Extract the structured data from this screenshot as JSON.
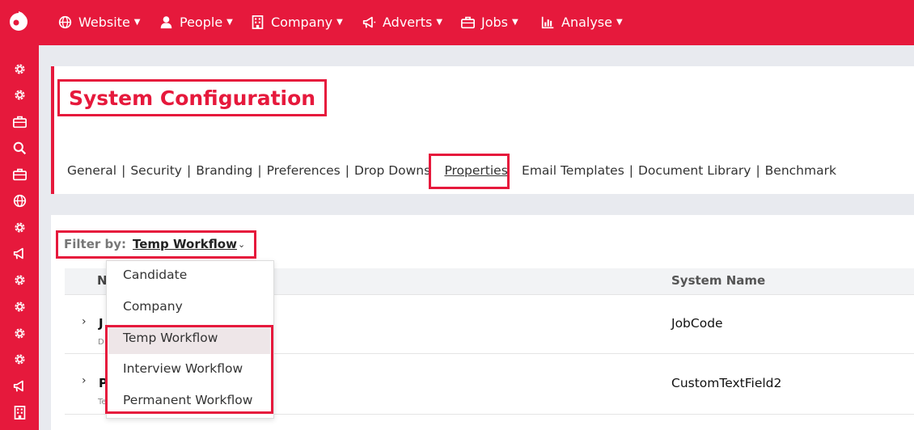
{
  "topnav": {
    "items": [
      {
        "label": "Website",
        "icon": "globe-icon"
      },
      {
        "label": "People",
        "icon": "user-icon"
      },
      {
        "label": "Company",
        "icon": "building-icon"
      },
      {
        "label": "Adverts",
        "icon": "megaphone-icon"
      },
      {
        "label": "Jobs",
        "icon": "briefcase-icon"
      },
      {
        "label": "Analyse",
        "icon": "chart-icon"
      }
    ]
  },
  "sidebar": {
    "icons": [
      "gear-icon",
      "gear-icon",
      "briefcase-icon",
      "search-icon",
      "briefcase-icon",
      "globe-icon",
      "gear-icon",
      "megaphone-icon",
      "gear-icon",
      "gear-icon",
      "gear-icon",
      "gear-icon",
      "megaphone-icon",
      "building-icon"
    ]
  },
  "page": {
    "title": "System Configuration",
    "config_nav": [
      {
        "label": "General"
      },
      {
        "label": "Security"
      },
      {
        "label": "Branding"
      },
      {
        "label": "Preferences"
      },
      {
        "label": "Drop Downs"
      },
      {
        "label": "Properties",
        "active": true
      },
      {
        "label": "Email Templates"
      },
      {
        "label": "Document Library"
      },
      {
        "label": "Benchmark"
      }
    ]
  },
  "filter": {
    "label": "Filter by:",
    "value": "Temp Workflow",
    "caret": "⌄"
  },
  "table": {
    "col_name_initial": "N",
    "col_system_name": "System Name",
    "rows": [
      {
        "initial": "J",
        "sub": "D",
        "system_name": "JobCode"
      },
      {
        "initial": "P",
        "sub": "Te",
        "system_name": "CustomTextField2"
      }
    ]
  },
  "dropdown": {
    "options": [
      "Candidate",
      "Company",
      "Temp Workflow",
      "Interview Workflow",
      "Permanent Workflow"
    ]
  },
  "colors": {
    "brand": "#e6193c",
    "background": "#e8eaef"
  }
}
